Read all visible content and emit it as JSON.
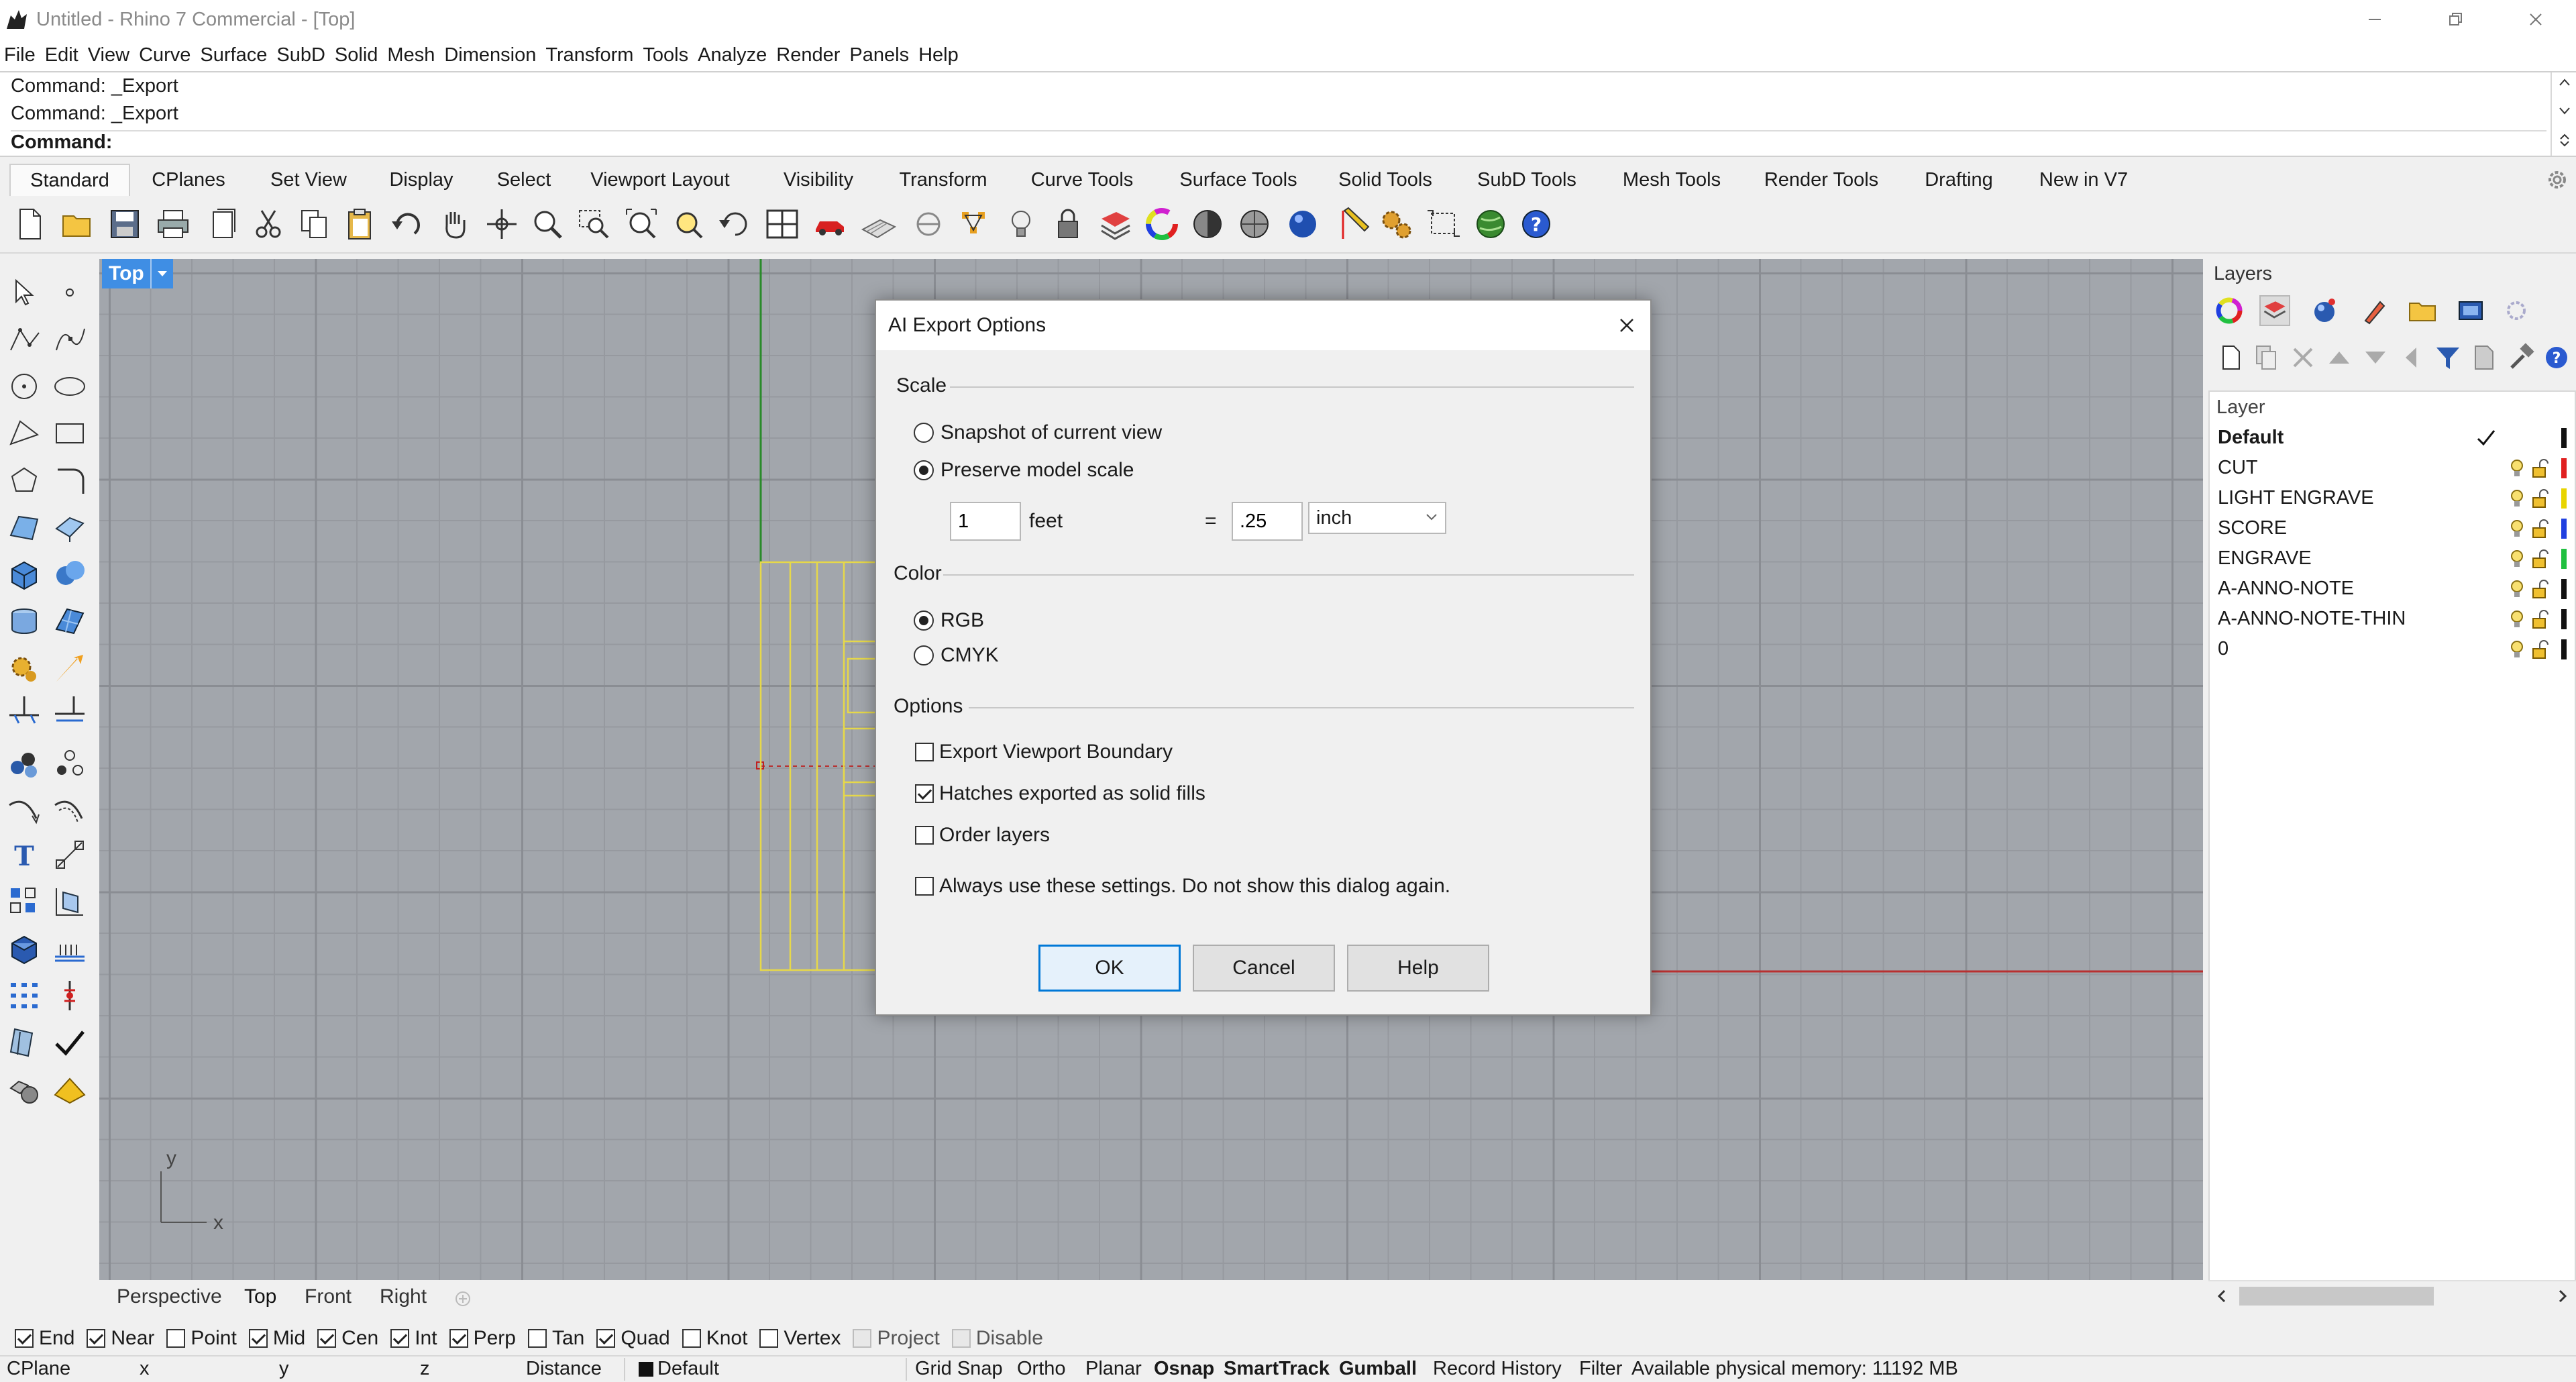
{
  "window": {
    "title": "Untitled - Rhino 7 Commercial - [Top]"
  },
  "menu": {
    "items": [
      "File",
      "Edit",
      "View",
      "Curve",
      "Surface",
      "SubD",
      "Solid",
      "Mesh",
      "Dimension",
      "Transform",
      "Tools",
      "Analyze",
      "Render",
      "Panels",
      "Help"
    ]
  },
  "command": {
    "history": [
      "Command: _Export",
      "Command: _Export"
    ],
    "prompt": "Command:"
  },
  "toolbar_tabs": {
    "items": [
      "Standard",
      "CPlanes",
      "Set View",
      "Display",
      "Select",
      "Viewport Layout",
      "Visibility",
      "Transform",
      "Curve Tools",
      "Surface Tools",
      "Solid Tools",
      "SubD Tools",
      "Mesh Tools",
      "Render Tools",
      "Drafting",
      "New in V7"
    ],
    "active": "Standard"
  },
  "viewport": {
    "label": "Top",
    "axis_x": "x",
    "axis_y": "y"
  },
  "view_tabs": {
    "items": [
      "Perspective",
      "Top",
      "Front",
      "Right"
    ],
    "active": "Top"
  },
  "layers_panel": {
    "title": "Layers",
    "column_header": "Layer",
    "layers": [
      {
        "name": "Default",
        "current": true,
        "color": "#111111"
      },
      {
        "name": "CUT",
        "current": false,
        "color": "#e02020"
      },
      {
        "name": "LIGHT ENGRAVE",
        "current": false,
        "color": "#e8d400"
      },
      {
        "name": "SCORE",
        "current": false,
        "color": "#2040e0"
      },
      {
        "name": "ENGRAVE",
        "current": false,
        "color": "#20c040"
      },
      {
        "name": "A-ANNO-NOTE",
        "current": false,
        "color": "#111111"
      },
      {
        "name": "A-ANNO-NOTE-THIN",
        "current": false,
        "color": "#111111"
      },
      {
        "name": "0",
        "current": false,
        "color": "#111111"
      }
    ]
  },
  "osnaps": [
    {
      "label": "End",
      "checked": true
    },
    {
      "label": "Near",
      "checked": true
    },
    {
      "label": "Point",
      "checked": false
    },
    {
      "label": "Mid",
      "checked": true
    },
    {
      "label": "Cen",
      "checked": true
    },
    {
      "label": "Int",
      "checked": true
    },
    {
      "label": "Perp",
      "checked": true
    },
    {
      "label": "Tan",
      "checked": false
    },
    {
      "label": "Quad",
      "checked": true
    },
    {
      "label": "Knot",
      "checked": false
    },
    {
      "label": "Vertex",
      "checked": false
    },
    {
      "label": "Project",
      "checked": false,
      "disabled": true
    },
    {
      "label": "Disable",
      "checked": false,
      "disabled": true
    }
  ],
  "status": {
    "cplane": "CPlane",
    "x": "x",
    "y": "y",
    "z": "z",
    "distance": "Distance",
    "layer": "Default",
    "grid_snap": "Grid Snap",
    "ortho": "Ortho",
    "planar": "Planar",
    "osnap": "Osnap",
    "smarttrack": "SmartTrack",
    "gumball": "Gumball",
    "record_history": "Record History",
    "filter": "Filter",
    "memory": "Available physical memory: 11192 MB"
  },
  "dialog": {
    "title": "AI Export Options",
    "scale_section": "Scale",
    "snapshot_label": "Snapshot of current view",
    "preserve_label": "Preserve model scale",
    "scale_selected": "preserve",
    "model_value": "1",
    "model_unit": "feet",
    "equals": "=",
    "paper_value": ".25",
    "paper_unit": "inch",
    "color_section": "Color",
    "rgb_label": "RGB",
    "cmyk_label": "CMYK",
    "color_selected": "RGB",
    "options_section": "Options",
    "export_boundary_label": "Export Viewport Boundary",
    "export_boundary_checked": false,
    "hatches_label": "Hatches exported as solid fills",
    "hatches_checked": true,
    "order_layers_label": "Order layers",
    "order_layers_checked": false,
    "always_use_label": "Always use these settings. Do not show this dialog again.",
    "always_use_checked": false,
    "ok_label": "OK",
    "cancel_label": "Cancel",
    "help_label": "Help"
  }
}
